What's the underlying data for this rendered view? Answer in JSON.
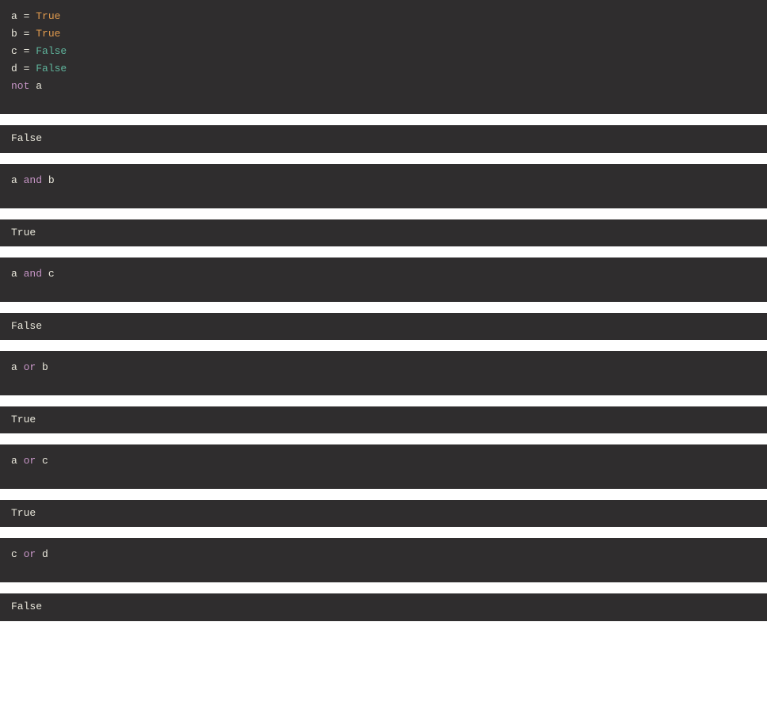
{
  "cells": [
    {
      "type": "code",
      "lines": [
        {
          "tokens": [
            {
              "t": "a ",
              "c": "var"
            },
            {
              "t": "= ",
              "c": "op"
            },
            {
              "t": "True",
              "c": "true"
            }
          ]
        },
        {
          "tokens": [
            {
              "t": "b ",
              "c": "var"
            },
            {
              "t": "= ",
              "c": "op"
            },
            {
              "t": "True",
              "c": "true"
            }
          ]
        },
        {
          "tokens": [
            {
              "t": "c ",
              "c": "var"
            },
            {
              "t": "= ",
              "c": "op"
            },
            {
              "t": "False",
              "c": "false"
            }
          ]
        },
        {
          "tokens": [
            {
              "t": "d ",
              "c": "var"
            },
            {
              "t": "= ",
              "c": "op"
            },
            {
              "t": "False",
              "c": "false"
            }
          ]
        },
        {
          "tokens": [
            {
              "t": "not ",
              "c": "kw"
            },
            {
              "t": "a",
              "c": "var"
            }
          ]
        }
      ]
    },
    {
      "type": "output",
      "text": "False"
    },
    {
      "type": "code",
      "lines": [
        {
          "tokens": [
            {
              "t": "a ",
              "c": "var"
            },
            {
              "t": "and ",
              "c": "kw"
            },
            {
              "t": "b",
              "c": "var"
            }
          ]
        }
      ]
    },
    {
      "type": "output",
      "text": "True"
    },
    {
      "type": "code",
      "lines": [
        {
          "tokens": [
            {
              "t": "a ",
              "c": "var"
            },
            {
              "t": "and ",
              "c": "kw"
            },
            {
              "t": "c",
              "c": "var"
            }
          ]
        }
      ]
    },
    {
      "type": "output",
      "text": "False"
    },
    {
      "type": "code",
      "lines": [
        {
          "tokens": [
            {
              "t": "a ",
              "c": "var"
            },
            {
              "t": "or ",
              "c": "kw"
            },
            {
              "t": "b",
              "c": "var"
            }
          ]
        }
      ]
    },
    {
      "type": "output",
      "text": "True"
    },
    {
      "type": "code",
      "lines": [
        {
          "tokens": [
            {
              "t": "a ",
              "c": "var"
            },
            {
              "t": "or ",
              "c": "kw"
            },
            {
              "t": "c",
              "c": "var"
            }
          ]
        }
      ]
    },
    {
      "type": "output",
      "text": "True"
    },
    {
      "type": "code",
      "lines": [
        {
          "tokens": [
            {
              "t": "c ",
              "c": "var"
            },
            {
              "t": "or ",
              "c": "kw"
            },
            {
              "t": "d",
              "c": "var"
            }
          ]
        }
      ]
    },
    {
      "type": "output",
      "text": "False"
    }
  ]
}
